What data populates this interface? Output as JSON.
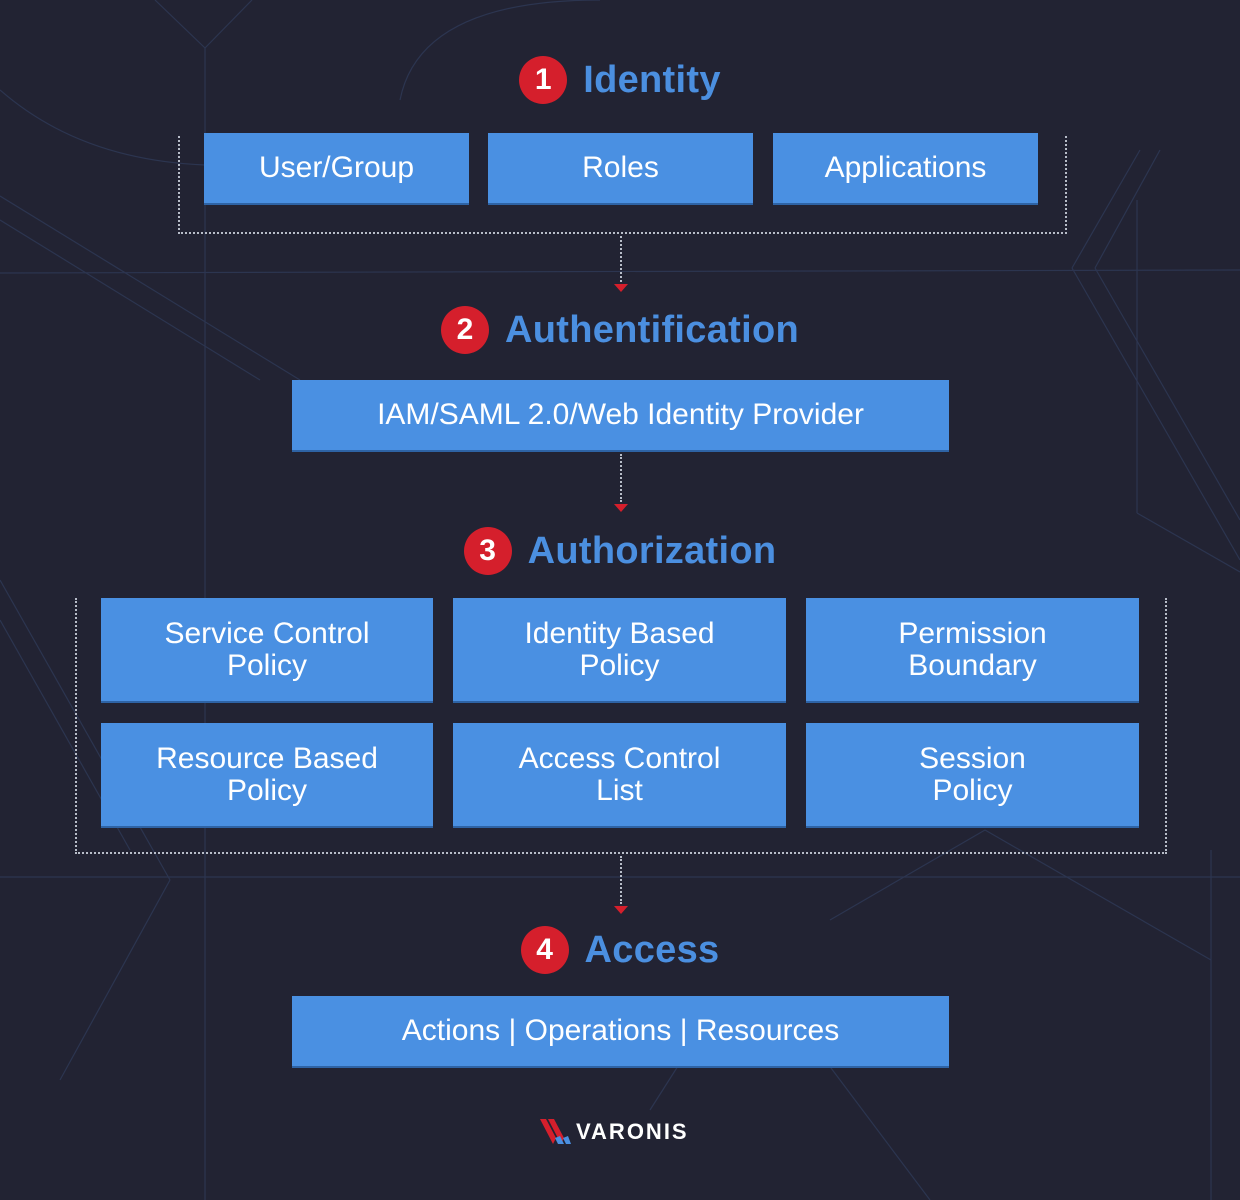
{
  "steps": [
    {
      "number": "1",
      "title": "Identity",
      "boxes": [
        "User/Group",
        "Roles",
        "Applications"
      ]
    },
    {
      "number": "2",
      "title": "Authentification",
      "boxes": [
        "IAM/SAML 2.0/Web Identity Provider"
      ]
    },
    {
      "number": "3",
      "title": "Authorization",
      "boxes": [
        "Service Control Policy",
        "Identity Based Policy",
        "Permission Boundary",
        "Resource Based Policy",
        "Access Control List",
        "Session Policy"
      ],
      "box_lines": [
        [
          "Service Control",
          "Policy"
        ],
        [
          "Identity Based",
          "Policy"
        ],
        [
          "Permission",
          "Boundary"
        ],
        [
          "Resource Based",
          "Policy"
        ],
        [
          "Access Control",
          "List"
        ],
        [
          "Session",
          "Policy"
        ]
      ]
    },
    {
      "number": "4",
      "title": "Access",
      "boxes": [
        "Actions | Operations | Resources"
      ]
    }
  ],
  "logo": {
    "text": "VARONIS"
  },
  "colors": {
    "background": "#222333",
    "accent_blue": "#4b8fe0",
    "box_blue": "#4a90e2",
    "badge_red": "#d51f2c"
  }
}
